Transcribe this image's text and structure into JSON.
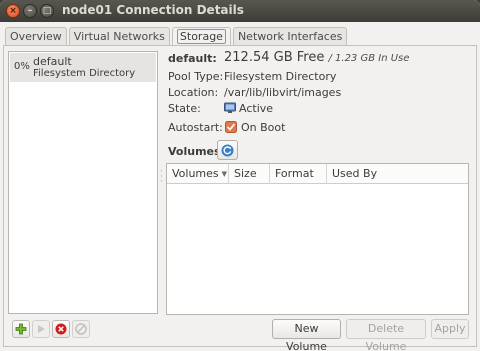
{
  "window": {
    "title": "node01 Connection Details"
  },
  "tabs": [
    {
      "label": "Overview",
      "active": false
    },
    {
      "label": "Virtual Networks",
      "active": false
    },
    {
      "label": "Storage",
      "active": true
    },
    {
      "label": "Network Interfaces",
      "active": false
    }
  ],
  "pools": [
    {
      "percent": "0%",
      "name": "default",
      "type": "Filesystem Directory",
      "selected": true
    }
  ],
  "details": {
    "header": "default:",
    "free": "212.54 GB Free",
    "in_use": "/ 1.23 GB In Use",
    "pool_type_label": "Pool Type:",
    "pool_type": "Filesystem Directory",
    "location_label": "Location:",
    "location": "/var/lib/libvirt/images",
    "state_label": "State:",
    "state": "Active",
    "autostart_label": "Autostart:",
    "autostart": "On Boot",
    "volumes_label": "Volumes"
  },
  "volumes_table": {
    "columns": [
      "Volumes",
      "Size",
      "Format",
      "Used By"
    ],
    "rows": []
  },
  "buttons": {
    "new_volume": "New Volume",
    "delete_volume": "Delete Volume",
    "apply": "Apply"
  },
  "icons": {
    "add_pool": "plus-icon",
    "start_pool": "play-icon",
    "stop_pool": "stop-icon",
    "delete_pool": "delete-icon",
    "refresh_volumes": "refresh-icon",
    "state": "monitor-icon",
    "autostart": "checkbox-icon"
  },
  "colors": {
    "titlebar": "#3d3c37",
    "active_tab_outline": "#e0794f",
    "add_green": "#4e9a06",
    "stop_red": "#cc0000"
  }
}
